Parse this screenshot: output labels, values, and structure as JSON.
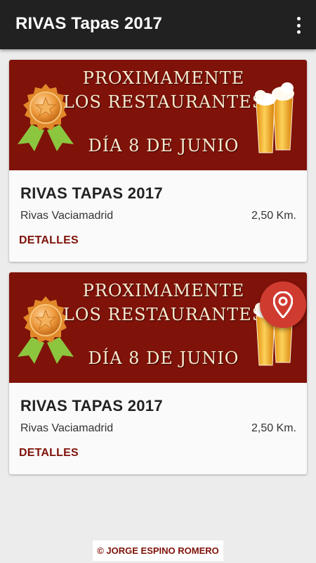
{
  "appbar": {
    "title": "RIVAS Tapas 2017",
    "menu_icon": "more-vert-icon"
  },
  "cards": [
    {
      "banner": {
        "line1": "PROXIMAMENTE",
        "line2": "LOS RESTAURANTES",
        "line3": "DÍA 8 DE JUNIO",
        "left_icon": "award-medal-icon",
        "right_icon": "beer-glasses-icon"
      },
      "name": "RIVAS TAPAS 2017",
      "place": "Rivas Vaciamadrid",
      "distance": "2,50 Km.",
      "details_label": "DETALLES"
    },
    {
      "banner": {
        "line1": "PROXIMAMENTE",
        "line2": "LOS RESTAURANTES",
        "line3": "DÍA 8 DE JUNIO",
        "left_icon": "award-medal-icon",
        "right_icon": "beer-glasses-icon"
      },
      "name": "RIVAS TAPAS 2017",
      "place": "Rivas Vaciamadrid",
      "distance": "2,50 Km.",
      "details_label": "DETALLES"
    }
  ],
  "fab": {
    "icon": "location-pin-icon"
  },
  "footer": {
    "copyright": "© JORGE ESPINO ROMERO"
  },
  "colors": {
    "appbar": "#212121",
    "accent": "#7f1209",
    "fab": "#d03b30",
    "background": "#ececec"
  }
}
